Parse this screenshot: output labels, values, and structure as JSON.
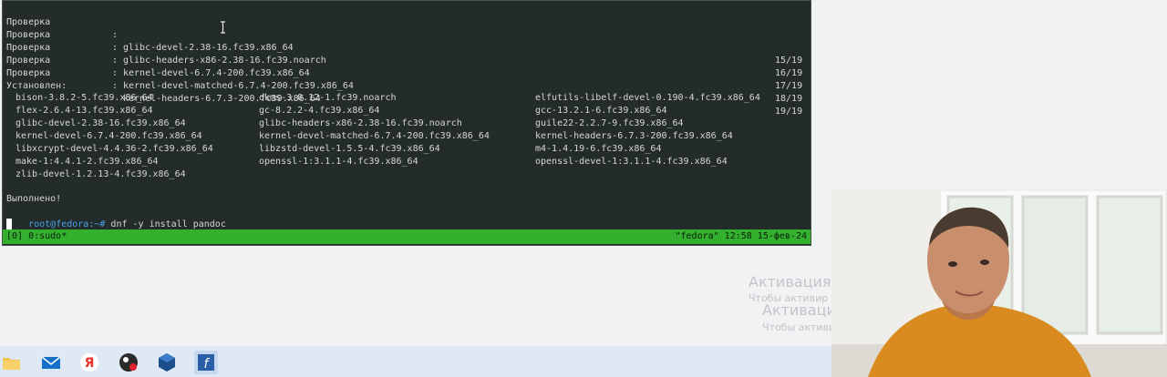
{
  "terminal": {
    "check_rows": [
      {
        "label": "Проверка",
        "colon": ":",
        "package": "glibc-devel-2.38-16.fc39.x86_64",
        "count": "15/19"
      },
      {
        "label": "Проверка",
        "colon": ":",
        "package": "glibc-headers-x86-2.38-16.fc39.noarch",
        "count": "16/19"
      },
      {
        "label": "Проверка",
        "colon": ":",
        "package": "kernel-devel-6.7.4-200.fc39.x86_64",
        "count": "17/19"
      },
      {
        "label": "Проверка",
        "colon": ":",
        "package": "kernel-devel-matched-6.7.4-200.fc39.x86_64",
        "count": "18/19"
      },
      {
        "label": "Проверка",
        "colon": ":",
        "package": "kernel-headers-6.7.3-200.fc39.x86_64",
        "count": "19/19"
      }
    ],
    "installed_heading": "Установлен:",
    "installed_packages": [
      [
        "bison-3.8.2-5.fc39.x86_64",
        "dkms-3.0.12-1.fc39.noarch",
        "elfutils-libelf-devel-0.190-4.fc39.x86_64"
      ],
      [
        "flex-2.6.4-13.fc39.x86_64",
        "gc-8.2.2-4.fc39.x86_64",
        "gcc-13.2.1-6.fc39.x86_64"
      ],
      [
        "glibc-devel-2.38-16.fc39.x86_64",
        "glibc-headers-x86-2.38-16.fc39.noarch",
        "guile22-2.2.7-9.fc39.x86_64"
      ],
      [
        "kernel-devel-6.7.4-200.fc39.x86_64",
        "kernel-devel-matched-6.7.4-200.fc39.x86_64",
        "kernel-headers-6.7.3-200.fc39.x86_64"
      ],
      [
        "libxcrypt-devel-4.4.36-2.fc39.x86_64",
        "libzstd-devel-1.5.5-4.fc39.x86_64",
        "m4-1.4.19-6.fc39.x86_64"
      ],
      [
        "make-1:4.4.1-2.fc39.x86_64",
        "openssl-1:3.1.1-4.fc39.x86_64",
        "openssl-devel-1:3.1.1-4.fc39.x86_64"
      ],
      [
        "zlib-devel-1.2.13-4.fc39.x86_64",
        "",
        ""
      ]
    ],
    "done_text": "Выполнено!",
    "prompt_user": "root@fedora",
    "prompt_path": ":~#",
    "command": "dnf -y install pandoc",
    "status_left": "[0] 0:sudo*",
    "status_right": "\"fedora\" 12:58 15-фев-24"
  },
  "watermark": {
    "title": "Активация Windows",
    "subtitle": "Чтобы активировать Windows, перейдите в раздел \"Па",
    "title_partial": "Активация W",
    "subtitle_partial": "Чтобы активир"
  },
  "taskbar": {
    "icons": [
      "folder-icon",
      "mail-icon",
      "yandex-icon",
      "obs-icon",
      "virtualbox-icon",
      "fedora-terminal-icon"
    ]
  },
  "colors": {
    "terminal_bg": "#232b2b",
    "status_bar": "#32b02e",
    "prompt_user": "#4aa2e8",
    "taskbar": "#dfe9f5"
  }
}
